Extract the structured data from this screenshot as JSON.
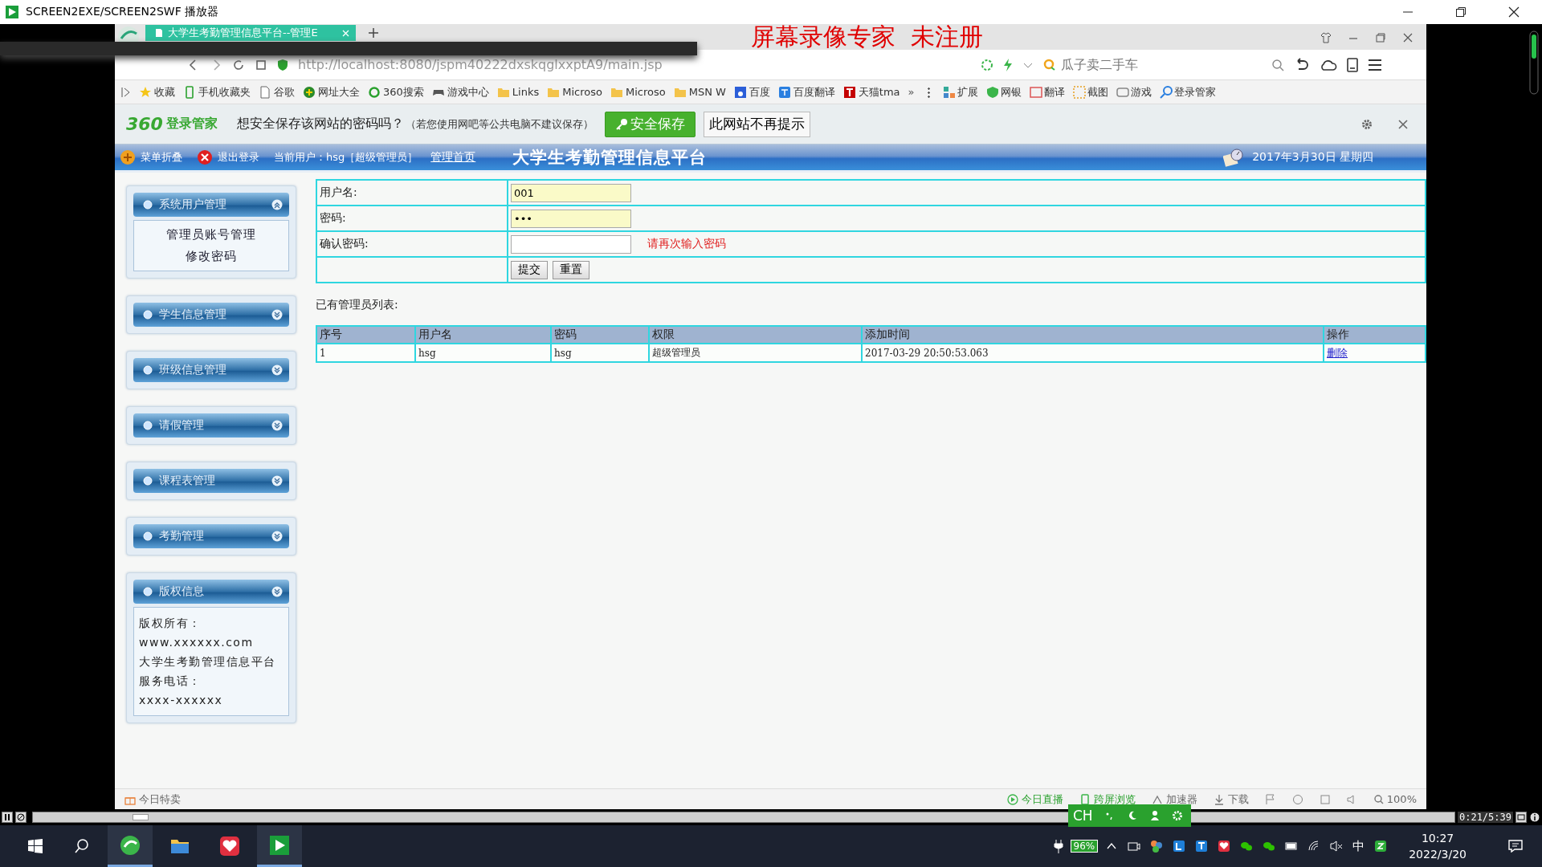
{
  "player": {
    "title": "SCREEN2EXE/SCREEN2SWF 播放器",
    "time": "0:21/5:39",
    "progress": {
      "level": 0.07
    }
  },
  "browser": {
    "tabs": [
      {
        "label": "大学生考勤管理信息平台--管理E",
        "selected": true
      }
    ],
    "address": "http://localhost:8080/jspm40222dxskqglxxptA9/main.jsp",
    "search_placeholder": "瓜子卖二手车",
    "bookmarks": [
      {
        "label": "收藏",
        "kind": "star"
      },
      {
        "label": "手机收藏夹",
        "kind": "phone"
      },
      {
        "label": "谷歌",
        "kind": "page"
      },
      {
        "label": "网址大全",
        "kind": "globe"
      },
      {
        "label": "360搜索",
        "kind": "search"
      },
      {
        "label": "游戏中心",
        "kind": "game"
      },
      {
        "label": "Links",
        "kind": "folder"
      },
      {
        "label": "Microso",
        "kind": "folder"
      },
      {
        "label": "Microso",
        "kind": "folder"
      },
      {
        "label": "MSN W",
        "kind": "folder"
      },
      {
        "label": "百度",
        "kind": "paw"
      },
      {
        "label": "百度翻译",
        "kind": "translate"
      },
      {
        "label": "天猫tma",
        "kind": "tmall"
      }
    ],
    "more": "»",
    "extensions": [
      "扩展",
      "网银",
      "翻译",
      "截图",
      "游戏",
      "登录管家"
    ]
  },
  "watermark": "屏幕录像专家  未注册",
  "password_bar": {
    "brand": "360",
    "brand_label": "登录管家",
    "question": "想安全保存该网站的密码吗？",
    "note": "（若您使用网吧等公共电脑不建议保存）",
    "save": "安全保存",
    "never": "此网站不再提示"
  },
  "header": {
    "collapse": "菜单折叠",
    "logout": "退出登录",
    "current_user": "当前用户：hsg［超级管理员］",
    "home_link": "管理首页",
    "title": "大学生考勤管理信息平台",
    "date": "2017年3月30日 星期四"
  },
  "sidebar": [
    {
      "title": "系统用户管理",
      "expanded": true,
      "kind": "menu",
      "items": [
        "管理员账号管理",
        "修改密码"
      ]
    },
    {
      "title": "学生信息管理",
      "expanded": false
    },
    {
      "title": "班级信息管理",
      "expanded": false
    },
    {
      "title": "请假管理",
      "expanded": false
    },
    {
      "title": "课程表管理",
      "expanded": false
    },
    {
      "title": "考勤管理",
      "expanded": false
    },
    {
      "title": "版权信息",
      "expanded": false,
      "kind": "info",
      "items": [
        "版权所有：",
        "www.xxxxxx.com",
        "大学生考勤管理信息平台",
        "服务电话：",
        "xxxx-xxxxxx"
      ]
    }
  ],
  "form": {
    "rows": [
      {
        "label": "用户名:",
        "value": "001",
        "autofilled": true
      },
      {
        "label": "密码:",
        "value": "•••",
        "autofilled": true
      },
      {
        "label": "确认密码:",
        "autofilled": false,
        "hint": "请再次输入密码"
      }
    ],
    "buttons": [
      "提交",
      "重置"
    ]
  },
  "admin_list": {
    "caption": "已有管理员列表:",
    "columns": [
      "序号",
      "用户名",
      "密码",
      "权限",
      "添加时间",
      "操作"
    ],
    "rows": [
      [
        "1",
        "hsg",
        "hsg",
        "超级管理员",
        "2017-03-29 20:50:53.063",
        "删除"
      ]
    ]
  },
  "status_bar": {
    "left": "今日特卖",
    "items": [
      "今日直播",
      "跨屏浏览",
      "加速器",
      "下载"
    ],
    "zoom": "100%"
  },
  "ime_bar": {
    "label": "CH"
  },
  "taskbar": {
    "battery": "96%",
    "ime": "中",
    "time": "10:27",
    "date": "2022/3/20"
  }
}
